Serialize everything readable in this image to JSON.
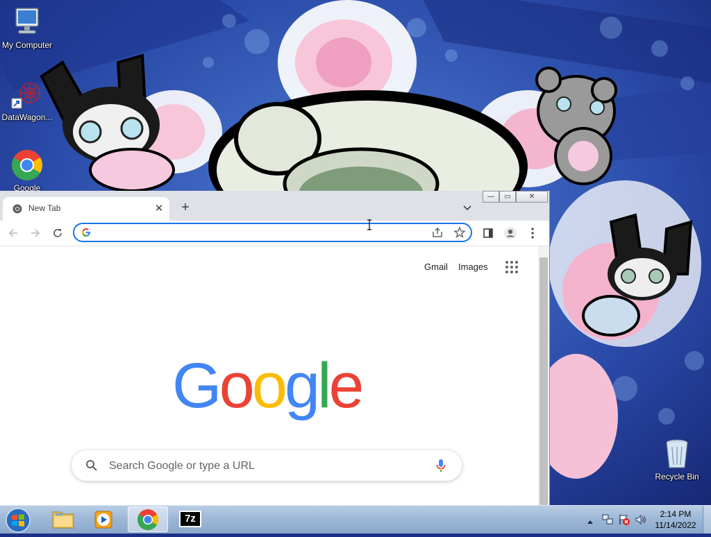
{
  "desktop": {
    "icons": [
      {
        "label": "My Computer",
        "icon": "computer-icon"
      },
      {
        "label": "DataWagon...",
        "icon": "datawagon-icon"
      },
      {
        "label": "Google",
        "icon": "chrome-icon"
      },
      {
        "label": "Recycle Bin",
        "icon": "recycle-bin-icon"
      }
    ]
  },
  "browser": {
    "tab": {
      "title": "New Tab",
      "close": "✕"
    },
    "new_tab": "+",
    "window_controls": {
      "minimize": "—",
      "maximize": "▭",
      "close": "✕"
    },
    "omnibox": {
      "value": "",
      "placeholder": ""
    },
    "toolbar_icons": [
      "back-icon",
      "forward-icon",
      "reload-icon",
      "share-icon",
      "bookmark-star-icon",
      "side-panel-icon",
      "profile-icon",
      "menu-icon"
    ],
    "page": {
      "links": {
        "gmail": "Gmail",
        "images": "Images"
      },
      "logo_text": "Google",
      "search": {
        "placeholder": "Search Google or type a URL",
        "value": ""
      }
    }
  },
  "taskbar": {
    "apps": [
      "windows-explorer",
      "media-player",
      "chrome",
      "7-zip"
    ],
    "active_app": "chrome",
    "app_labels": {
      "seven_zip": "7z"
    },
    "clock": {
      "time": "2:14 PM",
      "date": "11/14/2022"
    }
  },
  "colors": {
    "google_blue": "#4285F4",
    "google_red": "#EA4335",
    "google_yellow": "#FBBC05",
    "google_green": "#34A853",
    "focus_ring": "#1a73e8"
  }
}
